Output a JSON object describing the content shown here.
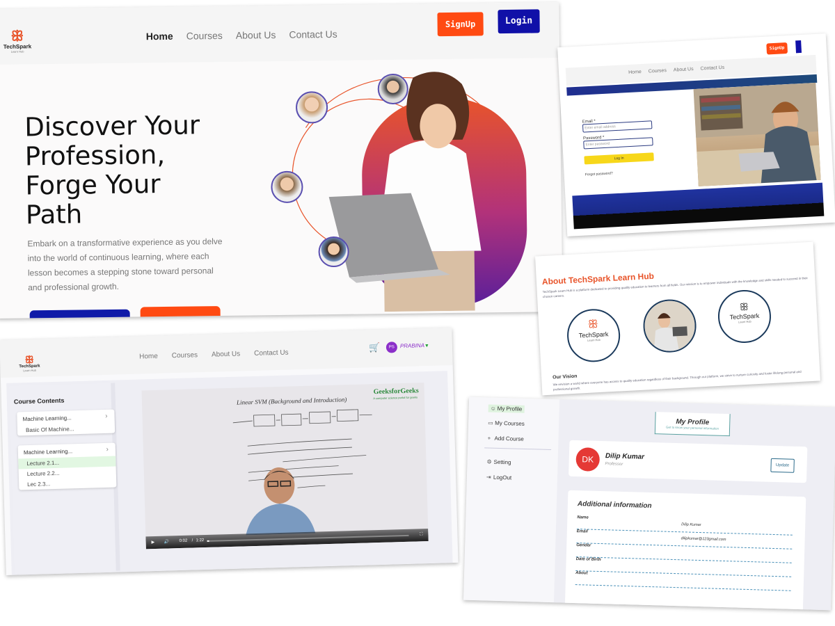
{
  "home": {
    "brand": {
      "name": "TechSpark",
      "tagline": "Learn Hub"
    },
    "nav": [
      "Home",
      "Courses",
      "About Us",
      "Contact Us"
    ],
    "signup_label": "SignUp",
    "login_label": "Login",
    "headline": "Discover Your Profession, Forge Your Path",
    "lead": "Embark on a transformative experience as you delve into the world of continuous learning, where each lesson becomes a stepping stone toward personal and professional growth."
  },
  "login_page": {
    "nav": [
      "Home",
      "Courses",
      "About Us",
      "Contact Us"
    ],
    "signup_label": "SignUp",
    "email_label": "Email *",
    "email_placeholder": "Enter email address",
    "password_label": "Password *",
    "password_placeholder": "Enter password",
    "submit_label": "Log In",
    "forgot_label": "Forgot password?"
  },
  "about": {
    "title": "About TechSpark Learn Hub",
    "paragraph": "TechSpark Learn Hub is a platform dedicated to providing quality education to learners from all fields. Our mission is to empower individuals with the knowledge and skills needed to succeed in their chosen careers.",
    "brand_name": "TechSpark",
    "brand_tagline": "Learn Hub",
    "vision_title": "Our Vision",
    "vision_text": "We envision a world where everyone has access to quality education regardless of their background. Through our platform, we strive to nurture curiosity and foster lifelong personal and professional growth."
  },
  "course": {
    "brand": {
      "name": "TechSpark",
      "tagline": "Learn Hub"
    },
    "nav": [
      "Home",
      "Courses",
      "About Us",
      "Contact Us"
    ],
    "user_initials": "PS",
    "user_name": "PRABINA",
    "sidebar_title": "Course Contents",
    "modules": [
      {
        "title": "Machine Learning...",
        "items": [
          "Basic Of Machine..."
        ]
      },
      {
        "title": "Machine Learning...",
        "items": [
          "Lecture 2.1...",
          "Lecture 2.2...",
          "Lec 2.3..."
        ]
      }
    ],
    "active_item": "Lecture 2.1...",
    "video": {
      "brand": "GeeksforGeeks",
      "brand_sub": "A computer science portal for geeks",
      "board_title": "Linear SVM (Background and Introduction)",
      "time_current": "0:02",
      "time_total": "1:22"
    }
  },
  "profile": {
    "menu": [
      {
        "icon": "user-icon",
        "label": "My Profile"
      },
      {
        "icon": "monitor-icon",
        "label": "My Courses"
      },
      {
        "icon": "plus-icon",
        "label": "Add Course"
      },
      {
        "icon": "gear-icon",
        "label": "Setting"
      },
      {
        "icon": "logout-icon",
        "label": "LogOut"
      }
    ],
    "tag_title": "My Profile",
    "tag_sub": "Get to know your personal information",
    "initials": "DK",
    "name": "Dilip Kumar",
    "role": "Professor",
    "update_label": "Update",
    "info_title": "Additional information",
    "fields": [
      {
        "label": "Name",
        "value": "Dilip Kumar"
      },
      {
        "label": "Email",
        "value": "dilipkumar@123gmail.com"
      },
      {
        "label": "Gender",
        "value": ""
      },
      {
        "label": "Date of Birth",
        "value": ""
      },
      {
        "label": "About",
        "value": ""
      }
    ]
  },
  "colors": {
    "accent_orange": "#ff4a12",
    "accent_navy": "#1010a8",
    "accent_green": "#1a9e2f",
    "accent_purple": "#8b2fc9"
  }
}
